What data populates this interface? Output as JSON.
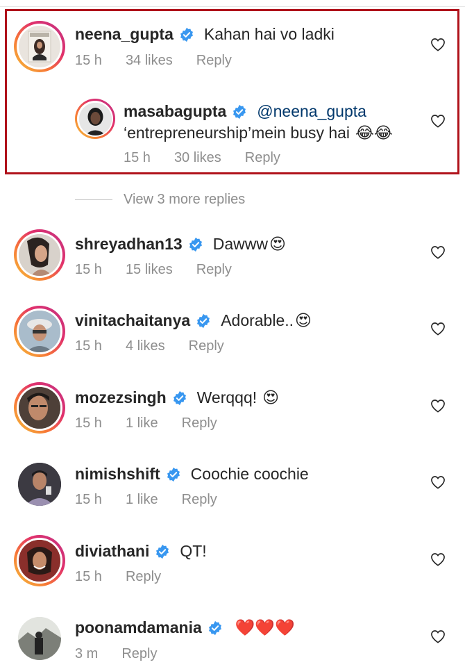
{
  "comments": [
    {
      "username": "neena_gupta",
      "text": "Kahan hai vo ladki",
      "time": "15 h",
      "likes": "34 likes",
      "reply": "Reply",
      "avatar": "magazine-cover-avatar"
    },
    {
      "username": "masabagupta",
      "mention": "@neena_gupta",
      "text": "‘entrepreneurship’mein busy hai",
      "emoji": "😂😂",
      "time": "15 h",
      "likes": "30 likes",
      "reply": "Reply",
      "avatar": "portrait-avatar"
    },
    {
      "username": "shreyadhan13",
      "text": "Dawww",
      "emoji": "😍",
      "time": "15 h",
      "likes": "15 likes",
      "reply": "Reply"
    },
    {
      "username": "vinitachaitanya",
      "text": "Adorable..",
      "emoji": "😍",
      "time": "15 h",
      "likes": "4 likes",
      "reply": "Reply"
    },
    {
      "username": "mozezsingh",
      "text": "Werqqq!",
      "emoji": "😍",
      "time": "15 h",
      "likes": "1 like",
      "reply": "Reply"
    },
    {
      "username": "nimishshift",
      "text": "Coochie coochie",
      "time": "15 h",
      "likes": "1 like",
      "reply": "Reply"
    },
    {
      "username": "diviathani",
      "text": "QT!",
      "time": "15 h",
      "reply": "Reply"
    },
    {
      "username": "poonamdamania",
      "emoji": "❤️❤️❤️",
      "time": "3 m",
      "reply": "Reply"
    }
  ],
  "view_more": "View 3 more replies",
  "colors": {
    "verified": "#3897f0",
    "highlight_border": "#b0121b",
    "meta_text": "#8e8e8e",
    "mention": "#00376b"
  }
}
